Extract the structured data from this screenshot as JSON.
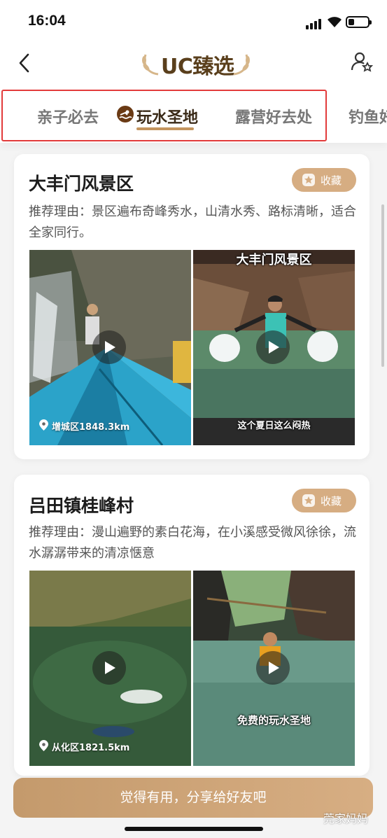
{
  "status_bar": {
    "time": "16:04"
  },
  "header": {
    "brand": "UC臻选"
  },
  "tabs": [
    {
      "label": "亲子必去"
    },
    {
      "label": "玩水圣地"
    },
    {
      "label": "露营好去处"
    },
    {
      "label": "钓鱼好"
    }
  ],
  "cards": [
    {
      "title": "大丰门风景区",
      "favorite_label": "收藏",
      "reason": "推荐理由：景区遍布奇峰秀水，山清水秀、路标清晰，适合全家同行。",
      "location": "增城区1848.3km",
      "video2_top_caption": "大丰门风景区",
      "video2_caption": "这个夏日这么闷热"
    },
    {
      "title": "吕田镇桂峰村",
      "favorite_label": "收藏",
      "reason": "推荐理由：漫山遍野的素白花海，在小溪感受微风徐徐，流水潺潺带来的清凉惬意",
      "location": "从化区1821.5km",
      "video2_caption": "免费的玩水圣地"
    }
  ],
  "share_button": "觉得有用，分享给好友吧",
  "watermark": "莞家妈妈",
  "colors": {
    "accent": "#c4955f",
    "favorite": "#d6ad82",
    "highlight": "#e23b3b"
  }
}
